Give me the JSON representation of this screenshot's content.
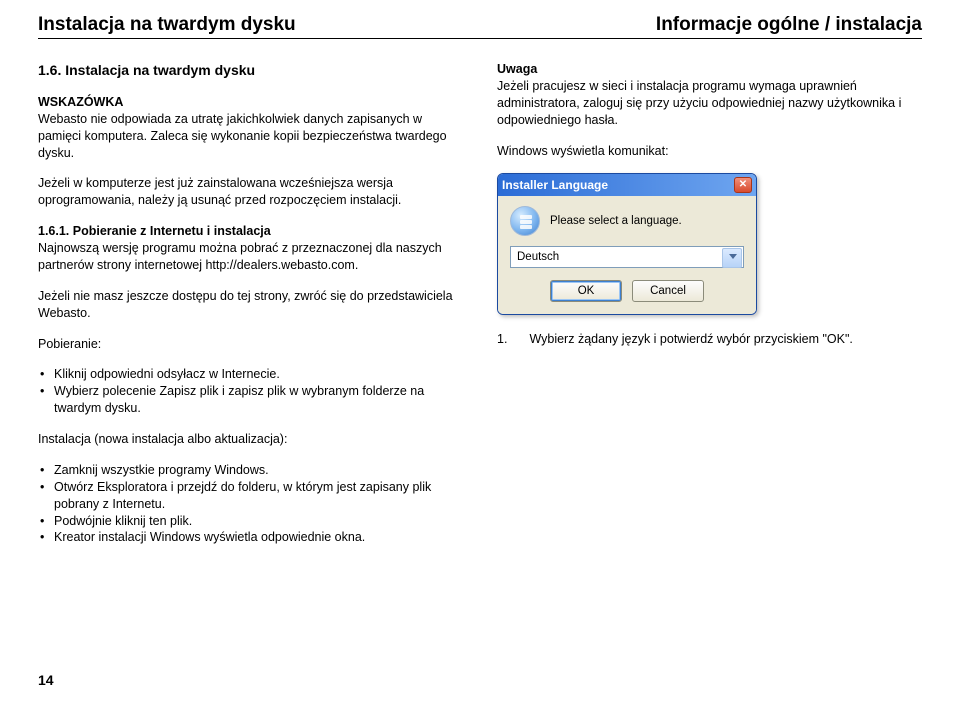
{
  "header": {
    "left": "Instalacja na twardym dysku",
    "right": "Informacje ogólne / instalacja"
  },
  "left": {
    "sectionTitle": "1.6.    Instalacja na twardym dysku",
    "hintLabel": "WSKAZÓWKA",
    "hintText": "Webasto nie odpowiada za utratę jakichkolwiek danych zapisanych w pamięci komputera. Zaleca się wykonanie kopii bezpieczeństwa twardego dysku.",
    "preinstallNote": "Jeżeli w komputerze jest już zainstalowana wcześniejsza wersja oprogramowania, należy ją usunąć przed rozpoczęciem instalacji.",
    "sub161Label": "1.6.1.    Pobieranie z Internetu i instalacja",
    "sub161Text": "Najnowszą wersję programu można pobrać z przeznaczonej dla naszych partnerów strony internetowej http://dealers.webasto.com.",
    "noAccessText": "Jeżeli nie masz jeszcze dostępu do tej strony, zwróć się do przedstawiciela Webasto.",
    "downloadLabel": "Pobieranie:",
    "downloadBullets": [
      "Kliknij odpowiedni odsyłacz w Internecie.",
      "Wybierz polecenie Zapisz plik i zapisz plik w wybranym folderze na twardym dysku."
    ],
    "installLabel": "Instalacja (nowa instalacja albo aktualizacja):",
    "installBullets": [
      "Zamknij wszystkie programy Windows.",
      "Otwórz Eksploratora i przejdź do folderu, w którym jest zapisany plik pobrany z Internetu.",
      "Podwójnie kliknij ten plik.",
      "Kreator instalacji Windows wyświetla odpowiednie okna."
    ]
  },
  "right": {
    "noteLabel": "Uwaga",
    "noteText": "Jeżeli pracujesz w sieci i instalacja programu wymaga uprawnień administratora, zaloguj się przy użyciu odpowiedniej nazwy użytkownika i odpowiedniego hasła.",
    "winMsg": "Windows wyświetla komunikat:",
    "dialog": {
      "title": "Installer Language",
      "prompt": "Please select a language.",
      "selected": "Deutsch",
      "ok": "OK",
      "cancel": "Cancel"
    },
    "step1num": "1.",
    "step1text": "Wybierz żądany język i potwierdź wybór przyciskiem \"OK\"."
  },
  "pageNumber": "14"
}
